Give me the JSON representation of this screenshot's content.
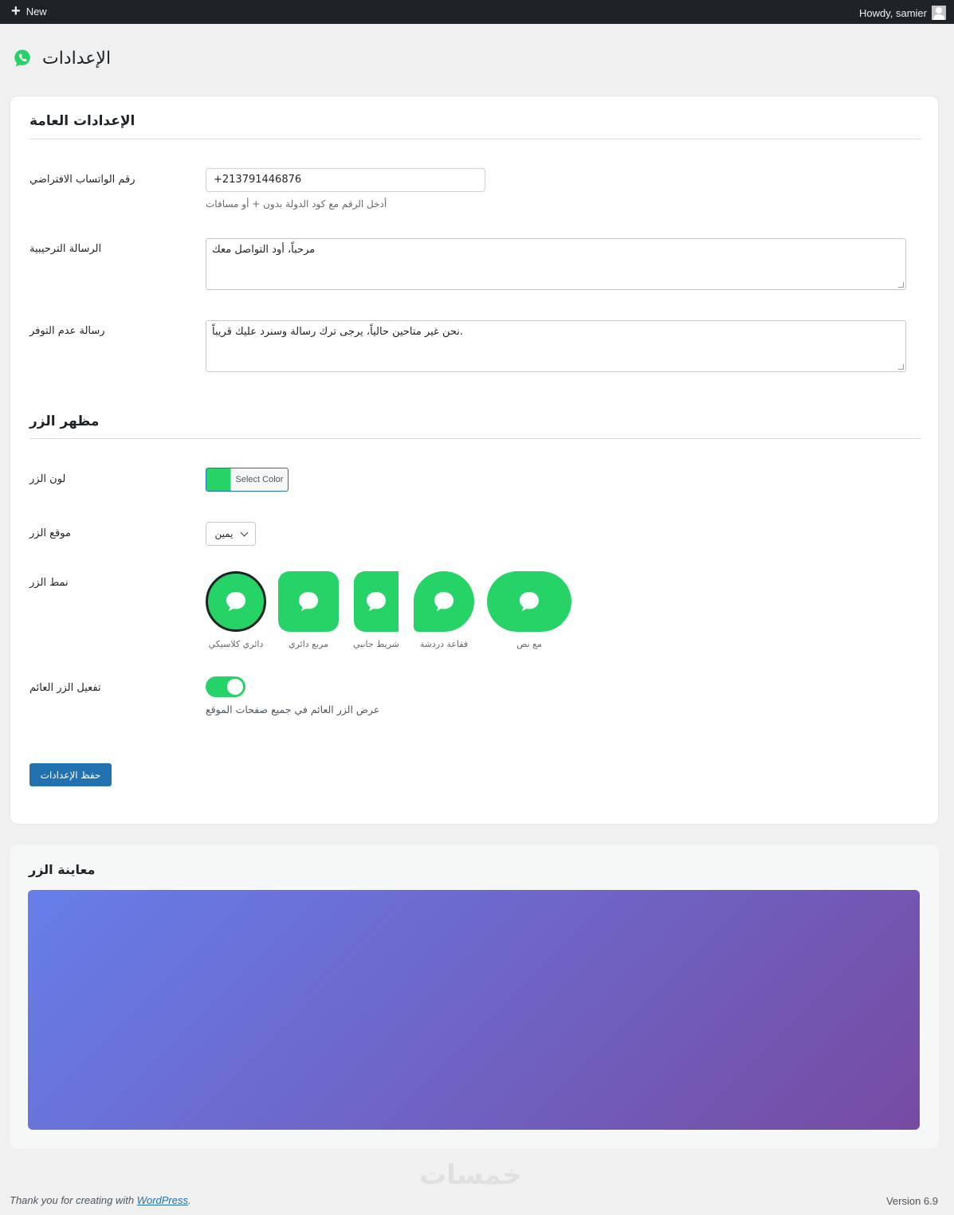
{
  "adminbar": {
    "new_label": "New",
    "howdy": "Howdy, samier"
  },
  "page": {
    "title": "الإعدادات"
  },
  "general": {
    "section_title": "الإعدادات العامة",
    "phone_label": "رقم الواتساب الافتراضي",
    "phone_value": "+213791446876",
    "phone_hint": "أدخل الرقم مع كود الدولة بدون + أو مسافات",
    "welcome_label": "الرسالة الترحيبية",
    "welcome_value": "مرحباً، أود التواصل معك",
    "offline_label": "رسالة عدم التوفر",
    "offline_value": "نحن غير متاحين حالياً، يرجى ترك رسالة وسنرد عليك قريباً."
  },
  "appearance": {
    "section_title": "مظهر الزر",
    "color_label": "لون الزر",
    "color_button": "Select Color",
    "color_value": "#25D366",
    "position_label": "موقع الزر",
    "position_value": "يمين",
    "style_label": "نمط الزر",
    "styles": [
      {
        "name": "دائري كلاسيكي",
        "selected": true
      },
      {
        "name": "مربع دائري",
        "selected": false
      },
      {
        "name": "شريط جانبي",
        "selected": false
      },
      {
        "name": "فقاعة دردشة",
        "selected": false
      },
      {
        "name": "مع نص",
        "selected": false
      }
    ],
    "floating_label": "تفعيل الزر العائم",
    "floating_enabled": true,
    "floating_hint": "عرض الزر العائم في جميع صفحات الموقع",
    "save_label": "حفظ الإعدادات"
  },
  "preview": {
    "title": "معاينة الزر"
  },
  "footer": {
    "thanks_prefix": "Thank you for creating with ",
    "wp_link": "WordPress",
    "thanks_suffix": ".",
    "version": "Version 6.9",
    "watermark": "خمسات"
  }
}
